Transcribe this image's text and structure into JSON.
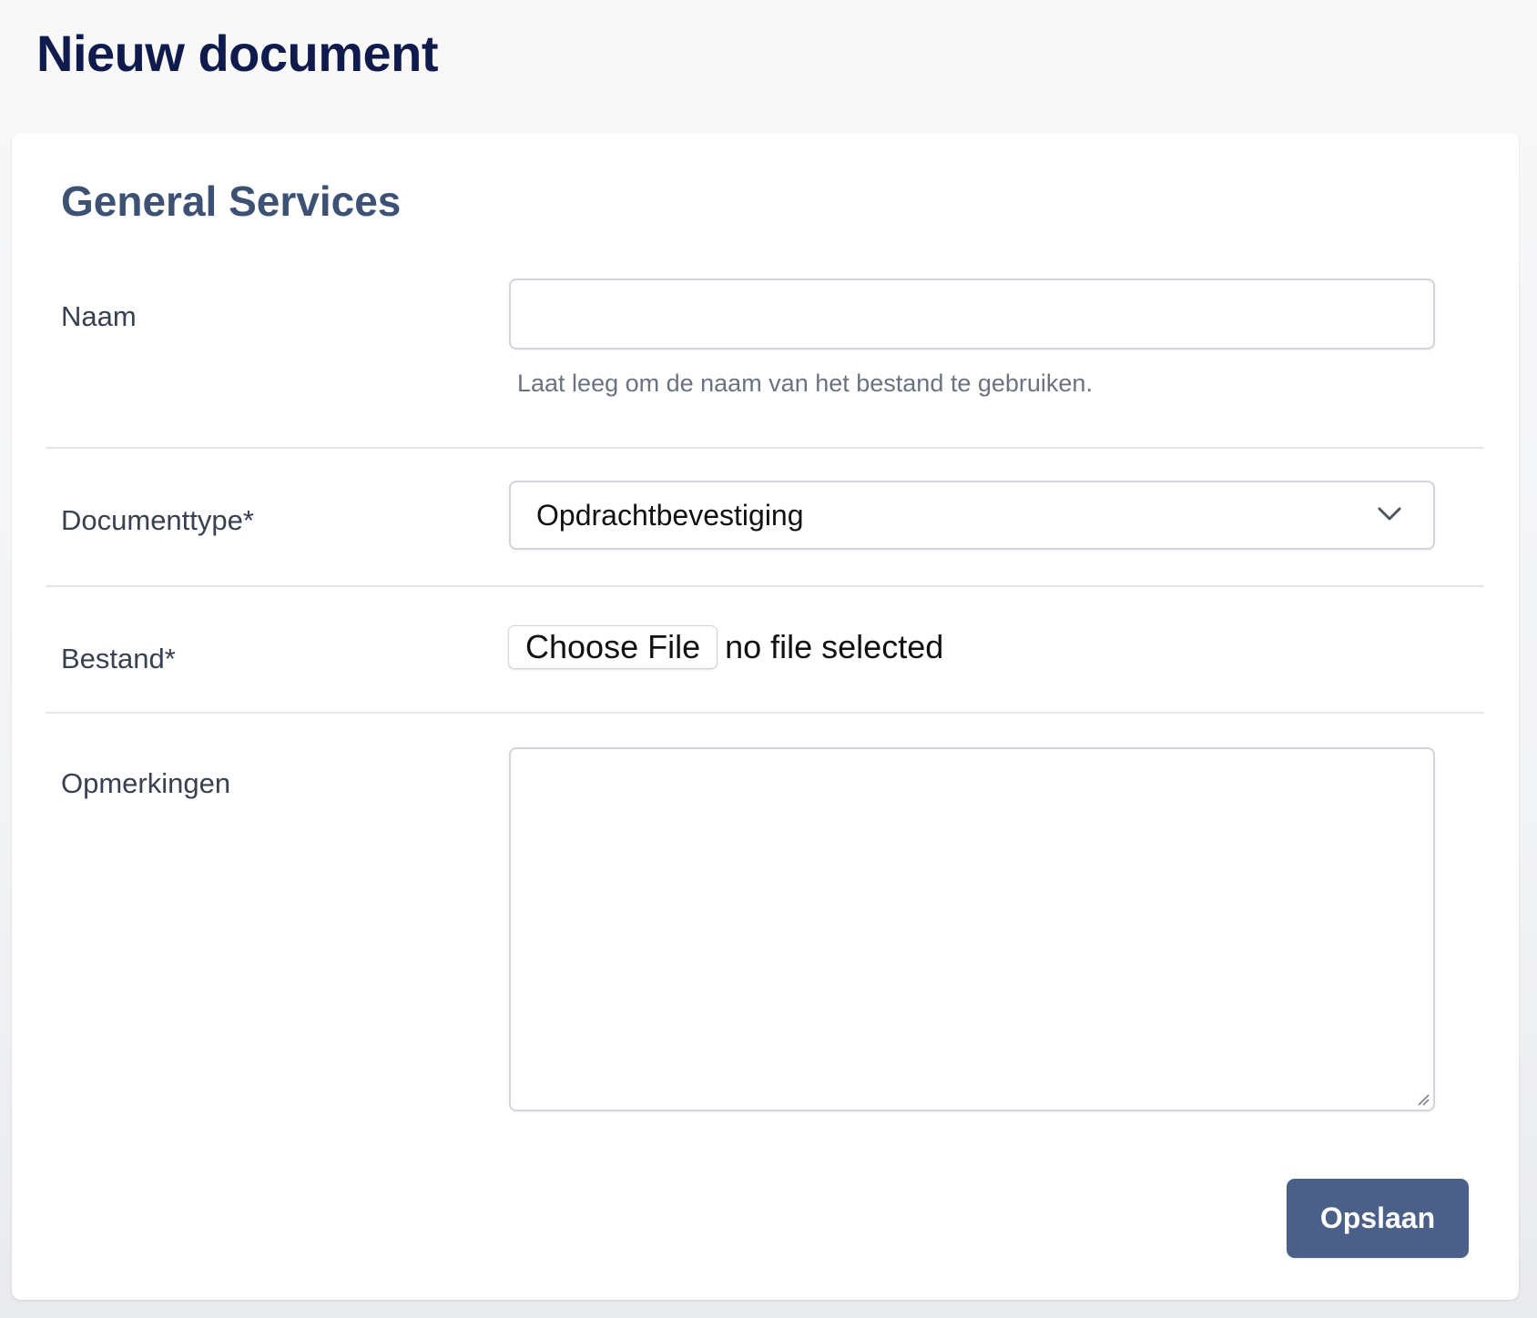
{
  "page": {
    "title": "Nieuw document"
  },
  "card": {
    "title": "General Services"
  },
  "form": {
    "naam": {
      "label": "Naam",
      "value": "",
      "help": "Laat leeg om de naam van het bestand te gebruiken."
    },
    "documenttype": {
      "label": "Documenttype*",
      "selected": "Opdrachtbevestiging"
    },
    "bestand": {
      "label": "Bestand*",
      "button": "Choose File",
      "status": "no file selected"
    },
    "opmerkingen": {
      "label": "Opmerkingen",
      "value": ""
    }
  },
  "actions": {
    "save_label": "Opslaan"
  },
  "colors": {
    "title": "#0f1b4c",
    "card_title": "#3d5175",
    "primary_button": "#4a6089"
  },
  "icons": {
    "select": "chevron-down-icon",
    "textarea": "resize-handle-icon"
  }
}
